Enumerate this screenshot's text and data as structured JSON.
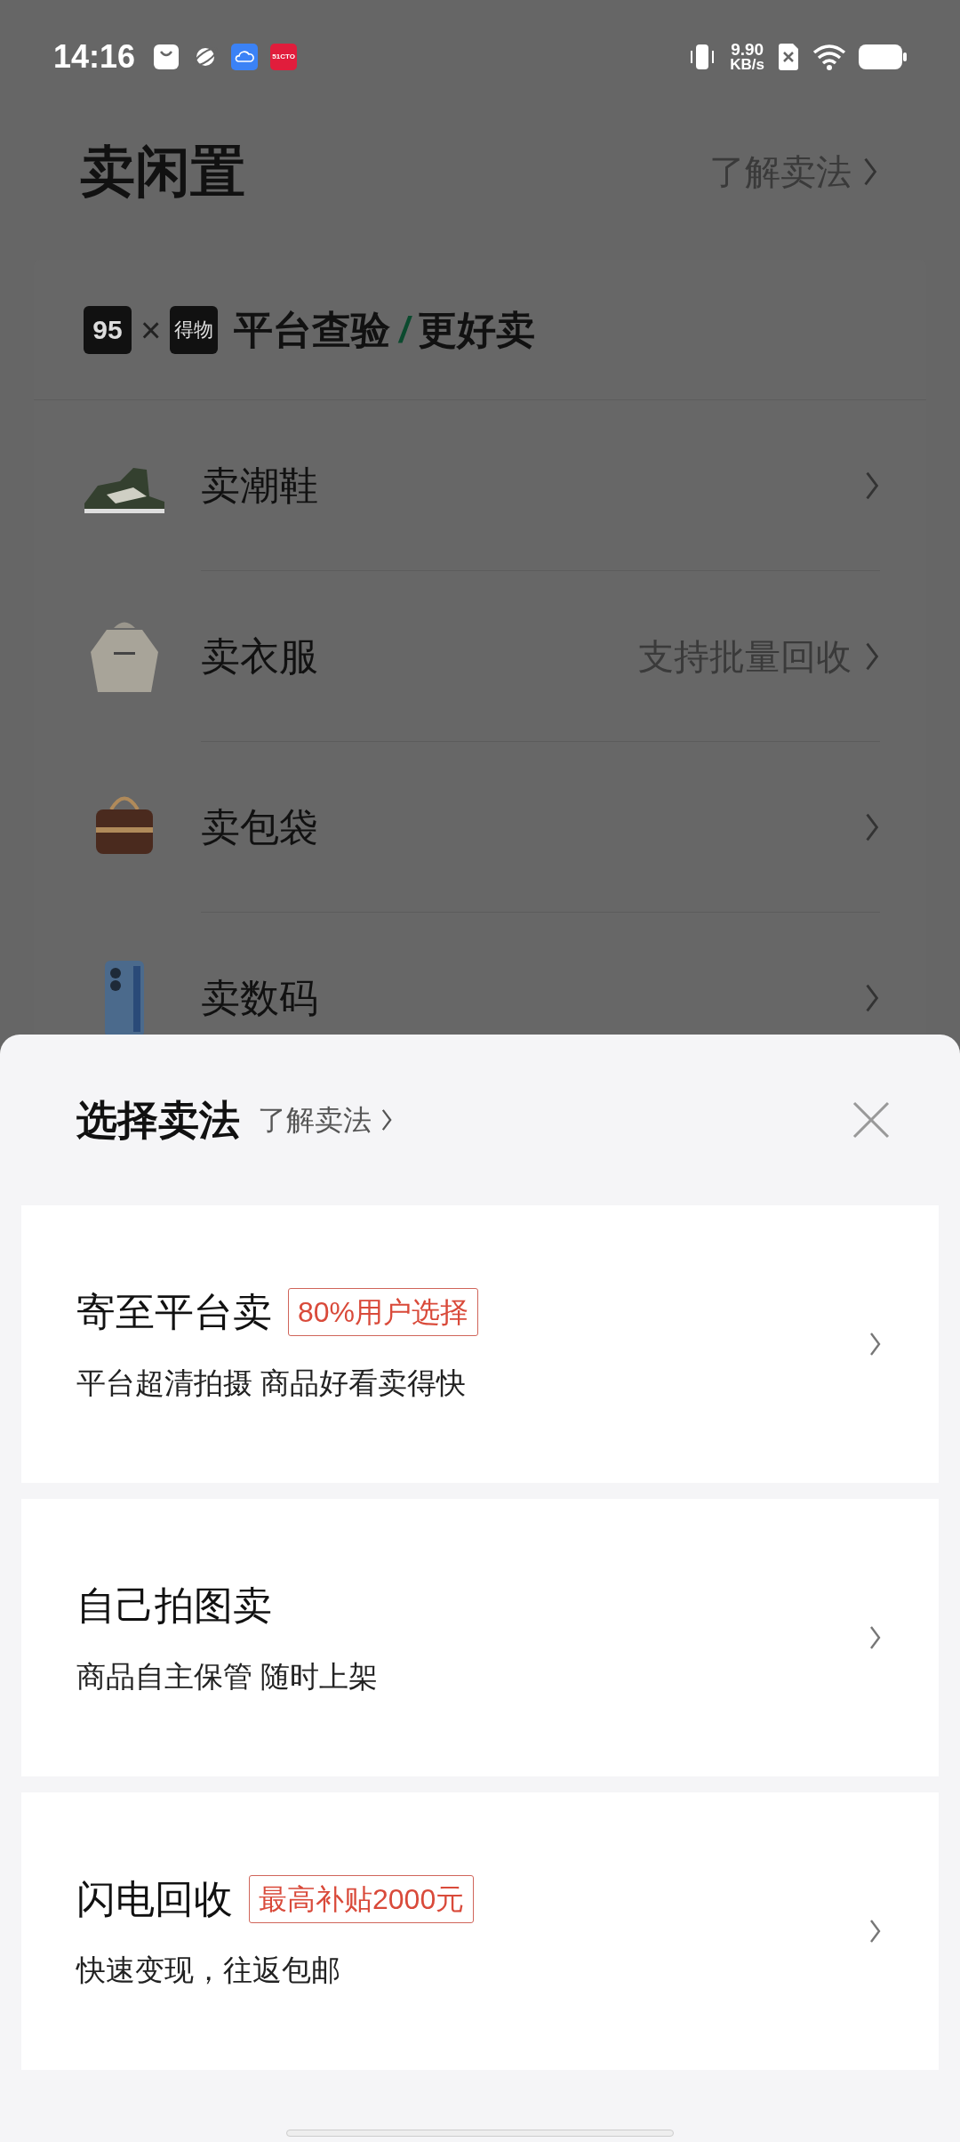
{
  "status_bar": {
    "time": "14:16",
    "app_icons": [
      {
        "kind": "bag"
      },
      {
        "kind": "planet"
      },
      {
        "kind": "cloud"
      },
      {
        "kind": "badge",
        "label": "51CTO"
      }
    ],
    "net_speed": {
      "value": "9.90",
      "unit": "KB/s"
    }
  },
  "header": {
    "title": "卖闲置",
    "link": "了解卖法"
  },
  "banner": {
    "logo_1": "95",
    "cross": "×",
    "logo_2": "得物",
    "text_1": "平台查验",
    "slash": "/",
    "text_2": "更好卖"
  },
  "categories": [
    {
      "label": "卖潮鞋"
    },
    {
      "label": "卖衣服",
      "note": "支持批量回收"
    },
    {
      "label": "卖包袋"
    },
    {
      "label": "卖数码"
    }
  ],
  "sheet": {
    "title": "选择卖法",
    "link": "了解卖法",
    "options": [
      {
        "title": "寄至平台卖",
        "tag": "80%用户选择",
        "description": "平台超清拍摄 商品好看卖得快"
      },
      {
        "title": "自己拍图卖",
        "description": "商品自主保管 随时上架"
      },
      {
        "title": "闪电回收",
        "tag": "最高补贴2000元",
        "description": "快速变现，往返包邮"
      }
    ]
  }
}
